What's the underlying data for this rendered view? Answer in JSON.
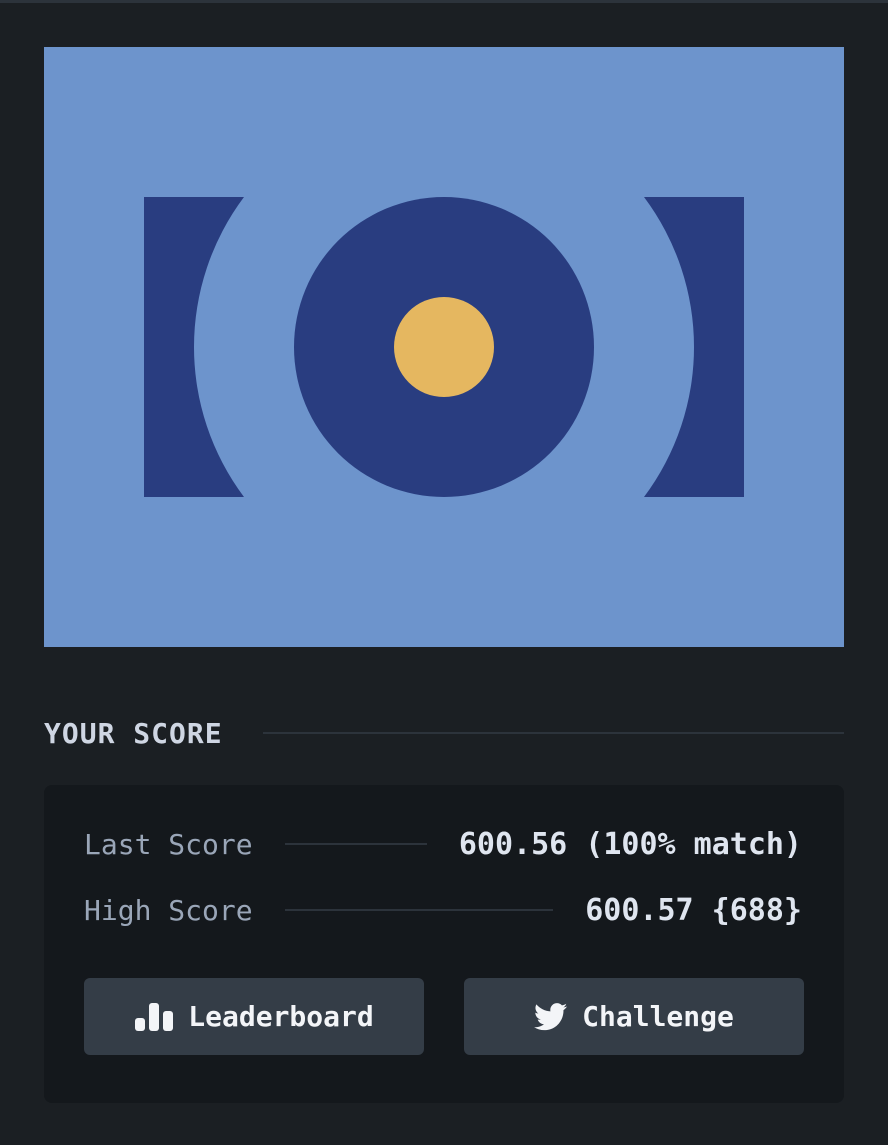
{
  "artwork": {
    "background_color": "#6d94cc",
    "shape_color": "#293d80",
    "center_dot_color": "#e5b760"
  },
  "score_section": {
    "heading": "YOUR SCORE"
  },
  "scores": {
    "last_label": "Last Score",
    "last_value": "600.56 (100% match)",
    "high_label": "High Score",
    "high_value": "600.57 {688}"
  },
  "buttons": {
    "leaderboard_label": "Leaderboard",
    "leaderboard_icon": "bar-chart-icon",
    "challenge_label": "Challenge",
    "challenge_icon": "twitter-bird-icon"
  },
  "colors": {
    "page_background": "#1b1f23",
    "panel_background": "#14181c",
    "button_background": "#343d47"
  }
}
